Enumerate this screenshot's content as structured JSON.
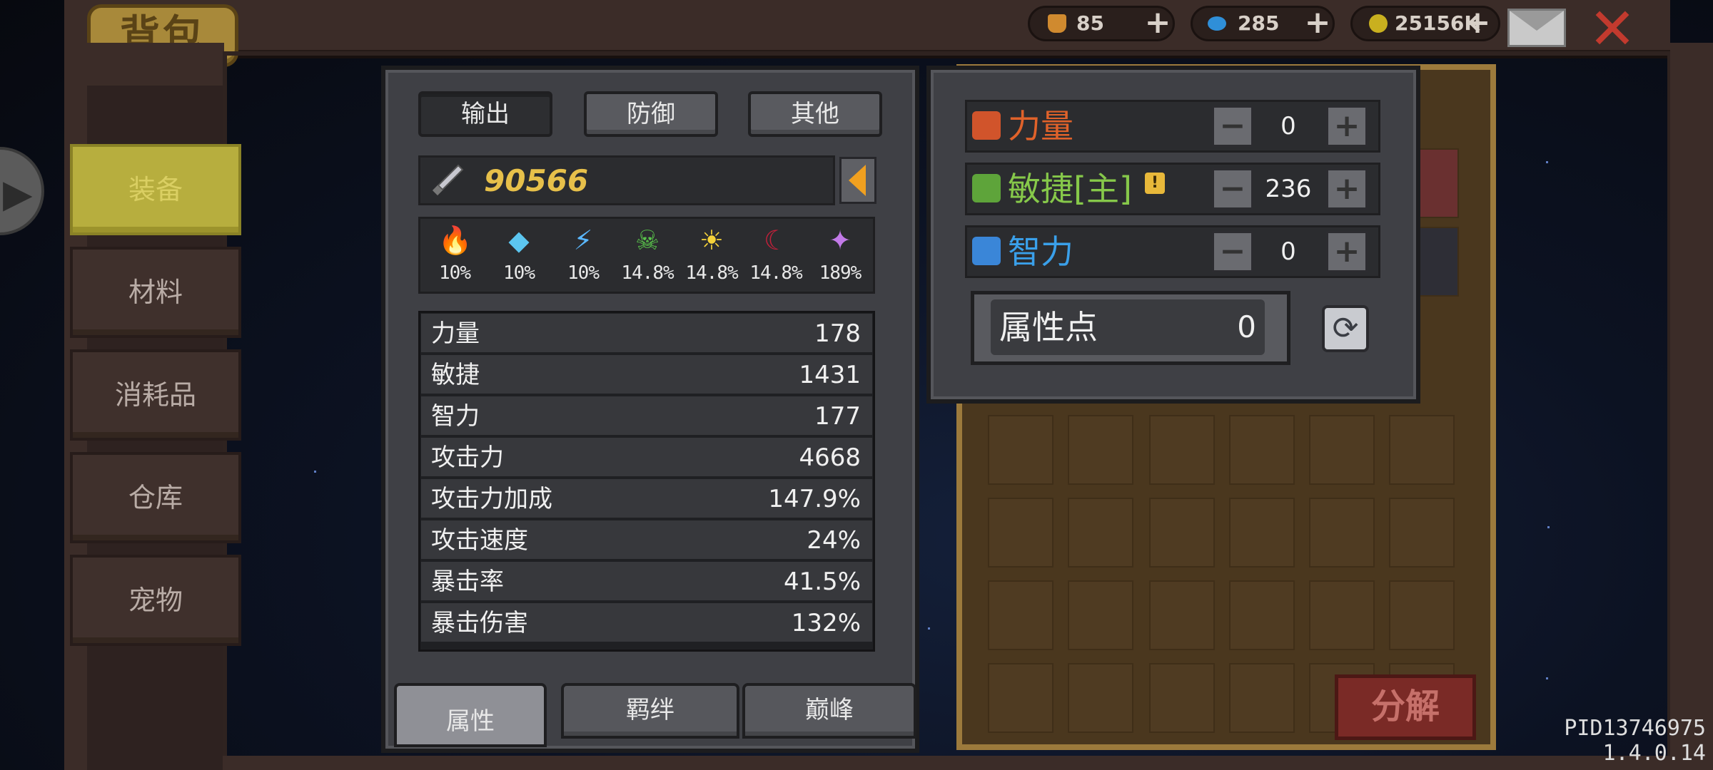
{
  "top": {
    "title": "背包",
    "resources": [
      {
        "name": "bottle",
        "value": "85",
        "color": "#d08a2f"
      },
      {
        "name": "gem",
        "value": "285",
        "color": "#2f8fd8"
      },
      {
        "name": "coin",
        "value": "25156K",
        "color": "#c9b01f"
      }
    ],
    "plus": "+"
  },
  "sidebar": {
    "items": [
      {
        "label": "装备",
        "active": true
      },
      {
        "label": "材料",
        "active": false
      },
      {
        "label": "消耗品",
        "active": false
      },
      {
        "label": "仓库",
        "active": false
      },
      {
        "label": "宠物",
        "active": false
      }
    ]
  },
  "stats": {
    "tabs": [
      {
        "label": "输出",
        "active": true
      },
      {
        "label": "防御",
        "active": false
      },
      {
        "label": "其他",
        "active": false
      }
    ],
    "power": "90566",
    "elements": [
      {
        "icon": "fire-icon",
        "glyph": "🔥",
        "color": "#f07a22",
        "pct": "10%"
      },
      {
        "icon": "ice-crystal-icon",
        "glyph": "◆",
        "color": "#5cc6f0",
        "pct": "10%"
      },
      {
        "icon": "lightning-icon",
        "glyph": "⚡",
        "color": "#5ab8ff",
        "pct": "10%"
      },
      {
        "icon": "poison-skull-icon",
        "glyph": "☠",
        "color": "#58c24a",
        "pct": "14.8%"
      },
      {
        "icon": "light-sun-icon",
        "glyph": "☀",
        "color": "#f5d23a",
        "pct": "14.8%"
      },
      {
        "icon": "dark-moon-icon",
        "glyph": "☾",
        "color": "#c2203a",
        "pct": "14.8%"
      },
      {
        "icon": "arcane-star-icon",
        "glyph": "✦",
        "color": "#c27ae8",
        "pct": "189%"
      }
    ],
    "attributes": [
      {
        "key": "力量",
        "value": "178"
      },
      {
        "key": "敏捷",
        "value": "1431"
      },
      {
        "key": "智力",
        "value": "177"
      },
      {
        "key": "攻击力",
        "value": "4668"
      },
      {
        "key": "攻击力加成",
        "value": "147.9%"
      },
      {
        "key": "攻击速度",
        "value": "24%"
      },
      {
        "key": "暴击率",
        "value": "41.5%"
      },
      {
        "key": "暴击伤害",
        "value": "132%"
      }
    ],
    "bottom_tabs": [
      {
        "label": "属性",
        "active": true
      },
      {
        "label": "羁绊",
        "active": false
      },
      {
        "label": "巅峰",
        "active": false
      }
    ]
  },
  "allocation": {
    "rows": [
      {
        "label": "力量",
        "value": "0",
        "color": "#e0622a",
        "icon_color": "#d1542b"
      },
      {
        "label": "敏捷[主]",
        "value": "236",
        "color": "#86c84a",
        "icon_color": "#5ea43a"
      },
      {
        "label": "智力",
        "value": "0",
        "color": "#3aa0ea",
        "icon_color": "#3a86d8"
      }
    ],
    "minus": "−",
    "plus": "+",
    "points_label": "属性点",
    "points_value": "0"
  },
  "inventory": {
    "decompose": "分解"
  },
  "footer": {
    "pid": "PID13746975 1.4.0.14"
  }
}
